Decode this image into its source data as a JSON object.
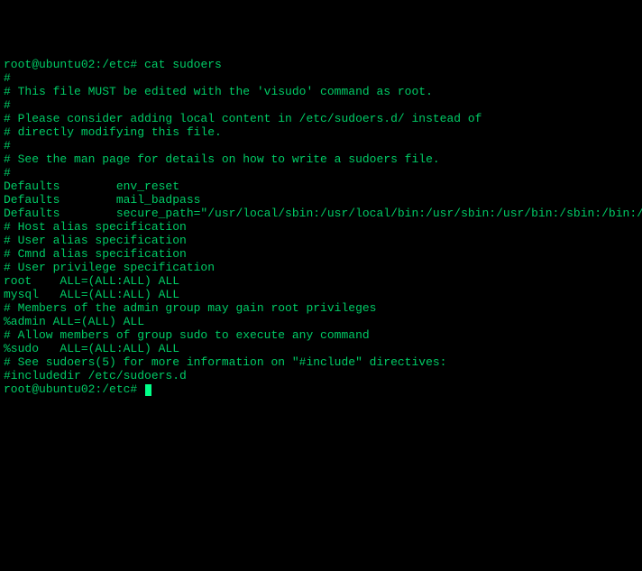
{
  "terminal": {
    "prompt1": "root@ubuntu02:/etc#",
    "command1": "cat sudoers",
    "lines": [
      "#",
      "# This file MUST be edited with the 'visudo' command as root.",
      "#",
      "# Please consider adding local content in /etc/sudoers.d/ instead of",
      "# directly modifying this file.",
      "#",
      "# See the man page for details on how to write a sudoers file.",
      "#",
      "Defaults        env_reset",
      "Defaults        mail_badpass",
      "Defaults        secure_path=\"/usr/local/sbin:/usr/local/bin:/usr/sbin:/usr/bin:/sbin:/bin:/snap/bin\"",
      "",
      "# Host alias specification",
      "",
      "# User alias specification",
      "",
      "# Cmnd alias specification",
      "",
      "# User privilege specification",
      "root    ALL=(ALL:ALL) ALL",
      "mysql   ALL=(ALL:ALL) ALL",
      "",
      "# Members of the admin group may gain root privileges",
      "%admin ALL=(ALL) ALL",
      "",
      "# Allow members of group sudo to execute any command",
      "%sudo   ALL=(ALL:ALL) ALL",
      "",
      "# See sudoers(5) for more information on \"#include\" directives:",
      "",
      "#includedir /etc/sudoers.d"
    ],
    "prompt2": "root@ubuntu02:/etc#"
  }
}
